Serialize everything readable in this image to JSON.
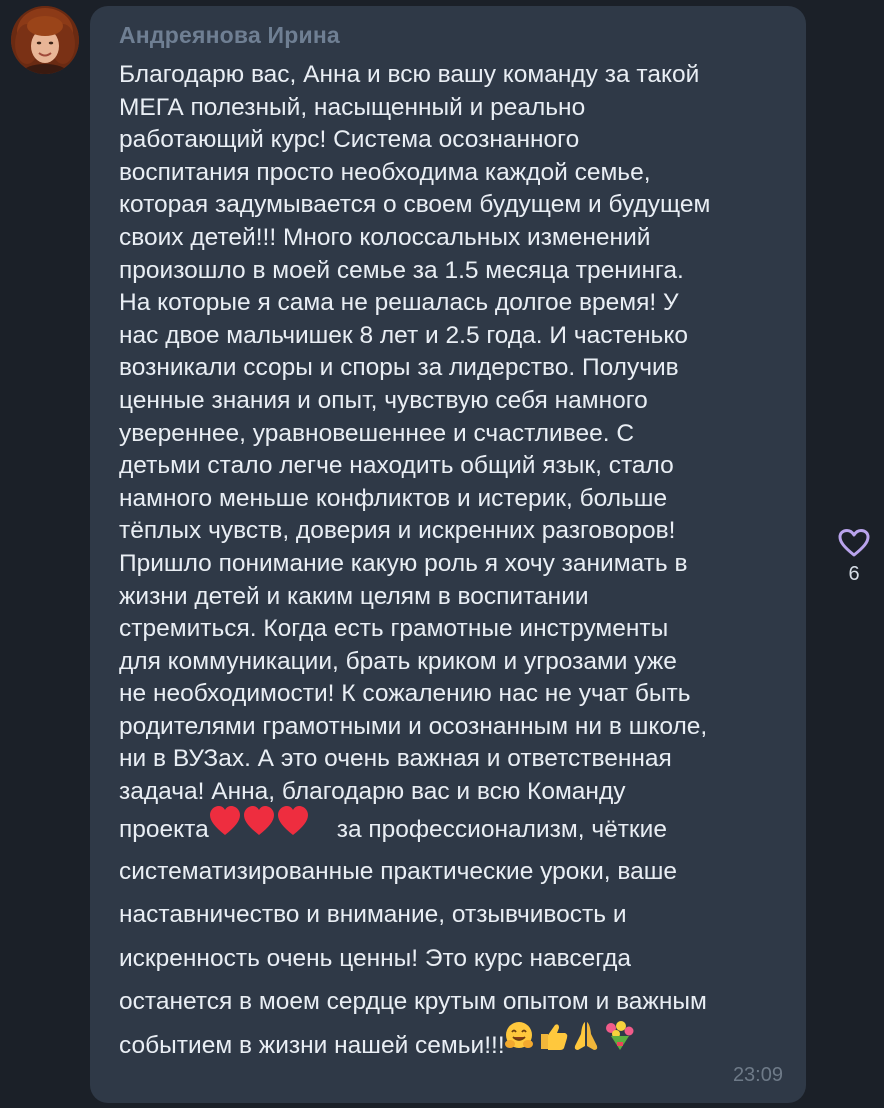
{
  "message": {
    "sender": "Андреянова Ирина",
    "lines": [
      "Благодарю вас, Анна и всю вашу команду за такой",
      "МЕГА полезный, насыщенный и реально",
      "работающий курс! Система осознанного",
      "воспитания просто необходима каждой семье,",
      "которая задумывается о своем будущем и будущем",
      "своих детей!!!  Много колоссальных изменений",
      "произошло в моей семье за 1.5 месяца тренинга.",
      "На которые я сама не решалась долгое время! У",
      "нас двое мальчишек 8 лет и 2.5 года. И частенько",
      "возникали ссоры и споры за лидерство. Получив",
      "ценные знания и опыт, чувствую себя намного",
      "увереннее, уравновешеннее и счастливее. С",
      "детьми стало легче находить общий язык, стало",
      "намного меньше конфликтов и истерик, больше",
      "тёплых чувств, доверия и искренних разговоров!",
      "Пришло понимание какую роль я хочу занимать в",
      "жизни детей и каким целям в воспитании",
      "стремиться. Когда есть грамотные инструменты",
      "для коммуникации, брать криком и угрозами уже",
      "не  необходимости! К сожалению нас не учат быть",
      "родителями грамотными и осознанным ни в школе,",
      "ни в ВУЗах. А это очень важная и ответственная",
      "задача! Анна, благодарю вас и всю Команду"
    ],
    "line_hearts_before": "проекта",
    "line_hearts_after": "за профессионализм, чёткие",
    "lines_tail": [
      "систематизированные практические уроки, ваше",
      "наставничество и внимание, отзывчивость и",
      "искренность очень ценны!  Это курс навсегда",
      "останется в моем сердце крутым опытом и важным"
    ],
    "last_line": "событием в жизни нашей семьи!!!",
    "time": "23:09"
  },
  "reaction": {
    "icon": "purple-heart-icon",
    "color": "#b9a3ec",
    "count": "6"
  }
}
